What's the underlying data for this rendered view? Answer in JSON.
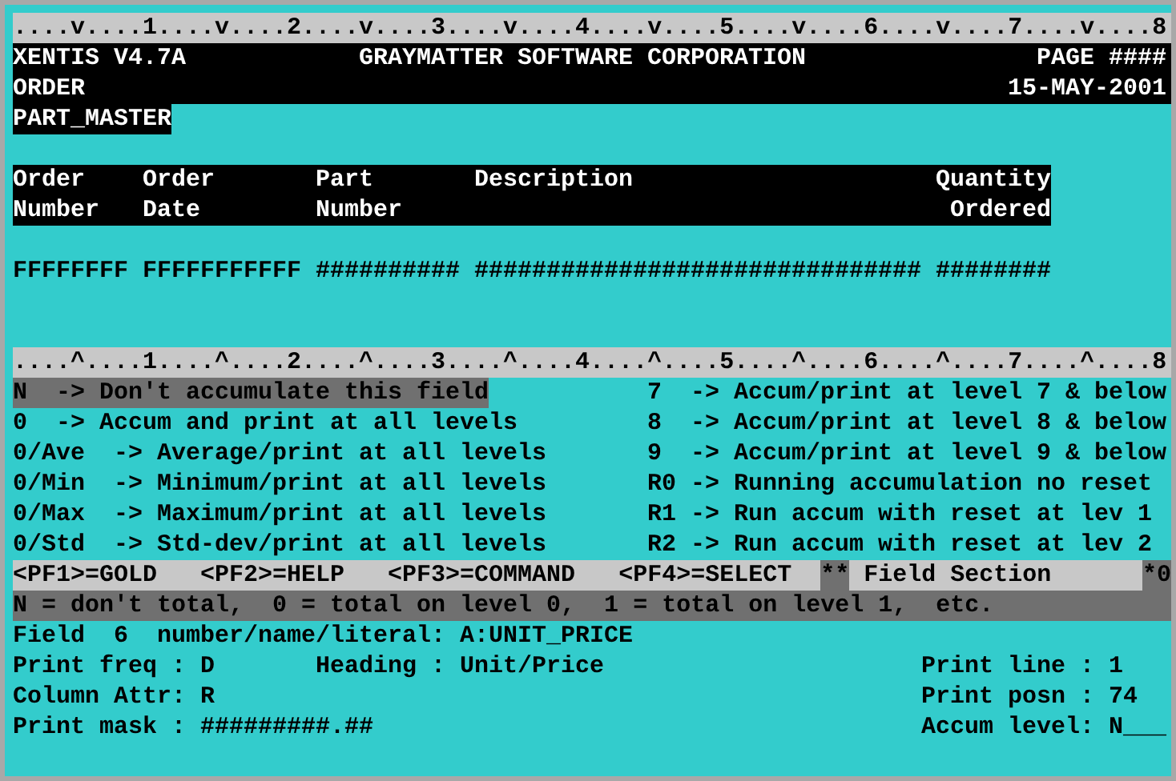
{
  "ruler_top": "....v....1....v....2....v....3....v....4....v....5....v....6....v....7....v....8",
  "header": {
    "product": "XENTIS V4.7A",
    "company": "GRAYMATTER SOFTWARE CORPORATION",
    "page": "PAGE ####",
    "report": "ORDER",
    "date": "15-MAY-2001",
    "file": "PART_MASTER"
  },
  "columns": [
    {
      "line_1": "Order",
      "line_2": "Number"
    },
    {
      "line_1": "Order",
      "line_2": "Date"
    },
    {
      "line_1": "Part",
      "line_2": "Number"
    },
    {
      "line_1": "Description"
    },
    {
      "line_1": "Quantity",
      "line_2": "Ordered"
    }
  ],
  "mask_row": [
    "FFFFFFFF",
    "FFFFFFFFFFF",
    "##########",
    "###############################",
    "########"
  ],
  "ruler_bottom": "....^....1....^....2....^....3....^....4....^....5....^....6....^....7....^....8",
  "options_left": [
    {
      "text": "N  -> Don't accumulate this field",
      "selected": true
    },
    {
      "text": "0  -> Accum and print at all levels",
      "selected": false
    },
    {
      "text": "0/Ave  -> Average/print at all levels",
      "selected": false
    },
    {
      "text": "0/Min  -> Minimum/print at all levels",
      "selected": false
    },
    {
      "text": "0/Max  -> Maximum/print at all levels",
      "selected": false
    },
    {
      "text": "0/Std  -> Std-dev/print at all levels",
      "selected": false
    }
  ],
  "options_right": [
    {
      "text": "7  -> Accum/print at level 7 & below",
      "selected": false
    },
    {
      "text": "8  -> Accum/print at level 8 & below",
      "selected": false
    },
    {
      "text": "9  -> Accum/print at level 9 & below",
      "selected": false
    },
    {
      "text": "R0 -> Running accumulation no reset",
      "selected": false
    },
    {
      "text": "R1 -> Run accum with reset at lev 1",
      "selected": false
    },
    {
      "text": "R2 -> Run accum with reset at lev 2",
      "selected": false
    }
  ],
  "function_keys": [
    "<PF1>=GOLD",
    "<PF2>=HELP",
    "<PF3>=COMMAND",
    "<PF4>=SELECT"
  ],
  "section_marker": "**",
  "section_title": "Field Section",
  "overflow_mark": "*0",
  "help_line": "N = don't total,  0 = total on level 0,  1 = total on level 1,  etc.",
  "field": {
    "label": "Field",
    "number": "6",
    "ref_label": "number/name/literal:",
    "ref_value": "A:UNIT_PRICE"
  },
  "form_left": [
    {
      "label": "Print freq :",
      "value": "D"
    },
    {
      "label": "Column Attr:",
      "value": "R"
    },
    {
      "label": "Print mask :",
      "value": "#########.##"
    }
  ],
  "heading": {
    "label": "Heading :",
    "value": "Unit/Price"
  },
  "form_right": [
    {
      "label": "Print line :",
      "value": "1"
    },
    {
      "label": "Print posn :",
      "value": "74"
    },
    {
      "label": "Accum level:",
      "value": "N___"
    }
  ]
}
